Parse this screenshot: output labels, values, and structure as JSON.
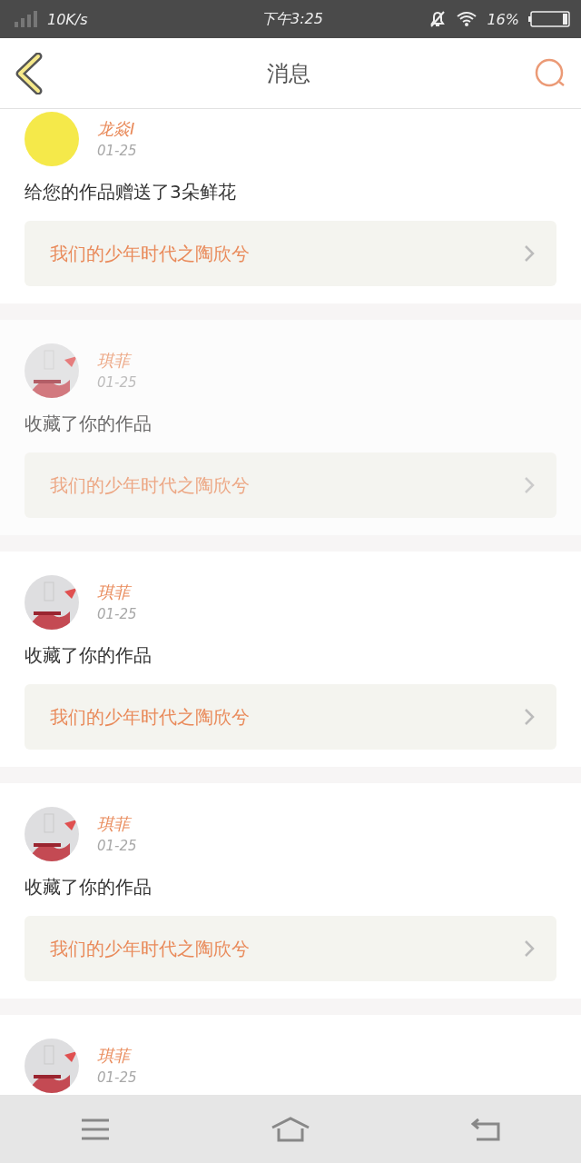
{
  "status_bar": {
    "speed": "10K/s",
    "time": "下午3:25",
    "battery": "16%"
  },
  "header": {
    "title": "消息"
  },
  "messages": [
    {
      "avatar": {
        "kind": "plain"
      },
      "name": "龙焱I",
      "date": "01-25",
      "text": "给您的作品赠送了3朵鲜花",
      "work": "我们的少年时代之陶欣兮",
      "pressed": false
    },
    {
      "name": "琪菲",
      "date": "01-25",
      "text": "收藏了你的作品",
      "work": "我们的少年时代之陶欣兮",
      "pressed": true
    },
    {
      "name": "琪菲",
      "date": "01-25",
      "text": "收藏了你的作品",
      "work": "我们的少年时代之陶欣兮",
      "pressed": false
    },
    {
      "name": "琪菲",
      "date": "01-25",
      "text": "收藏了你的作品",
      "work": "我们的少年时代之陶欣兮",
      "pressed": false
    },
    {
      "name": "琪菲",
      "date": "01-25",
      "pressed": false
    }
  ]
}
